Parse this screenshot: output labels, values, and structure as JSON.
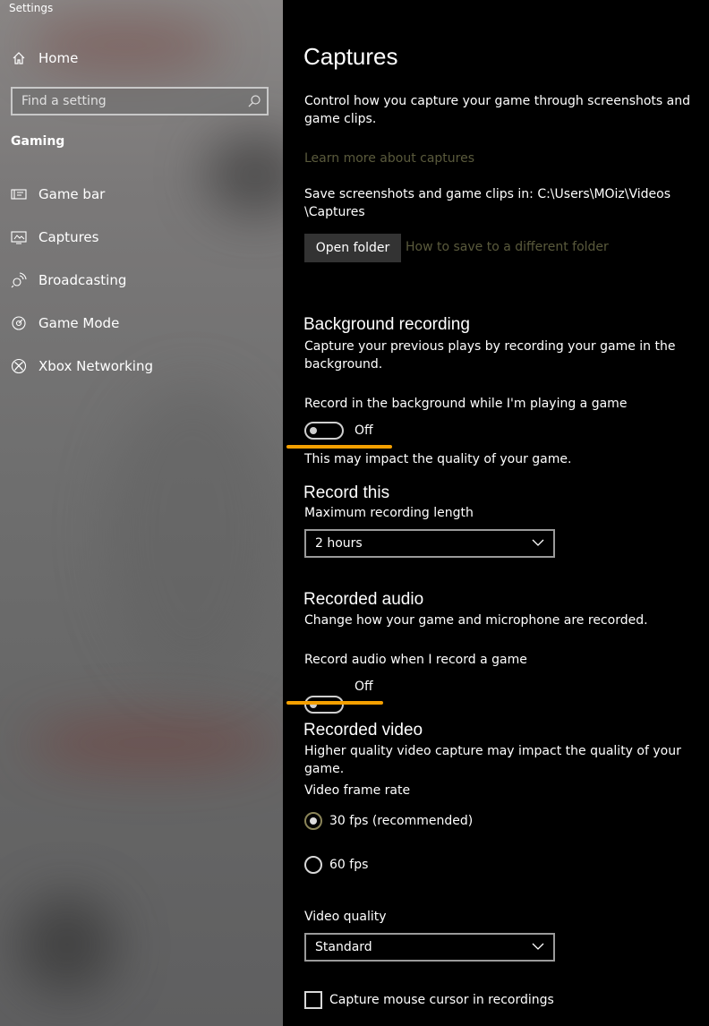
{
  "window": {
    "title": "Settings"
  },
  "sidebar": {
    "home_label": "Home",
    "search_placeholder": "Find a setting",
    "section": "Gaming",
    "items": [
      {
        "label": "Game bar",
        "icon": "game-bar-icon"
      },
      {
        "label": "Captures",
        "icon": "captures-icon"
      },
      {
        "label": "Broadcasting",
        "icon": "broadcasting-icon"
      },
      {
        "label": "Game Mode",
        "icon": "game-mode-icon"
      },
      {
        "label": "Xbox Networking",
        "icon": "xbox-icon"
      }
    ]
  },
  "main": {
    "title": "Captures",
    "intro_line1": "Control how you capture your game through screenshots and",
    "intro_line2": "game clips.",
    "learn_more": "Learn more about captures",
    "save_line1": "Save screenshots and game clips in: C:\\Users\\MOiz\\Videos",
    "save_line2": "\\Captures",
    "open_folder": "Open folder",
    "how_to_save": "How to save to a different folder",
    "background": {
      "heading": "Background recording",
      "desc_line1": "Capture your previous plays by recording your game in the",
      "desc_line2": "background.",
      "toggle_label": "Record in the background while I'm playing a game",
      "toggle_state": "Off",
      "note": "This may impact the quality of your game."
    },
    "record_this": {
      "heading": "Record this",
      "max_label": "Maximum recording length",
      "max_value": "2 hours"
    },
    "audio": {
      "heading": "Recorded audio",
      "desc": "Change how your game and microphone are recorded.",
      "toggle_label": "Record audio when I record a game",
      "toggle_state": "Off"
    },
    "video": {
      "heading": "Recorded video",
      "desc": "Higher quality video capture may impact the quality of your game.",
      "frame_rate_label": "Video frame rate",
      "fps_options": [
        "30 fps (recommended)",
        "60 fps"
      ],
      "selected_fps": "30 fps (recommended)",
      "quality_label": "Video quality",
      "quality_value": "Standard",
      "cursor_label": "Capture mouse cursor in recordings"
    }
  },
  "colors": {
    "highlight": "#f5a000",
    "accent_dim": "#5a5a3c"
  }
}
